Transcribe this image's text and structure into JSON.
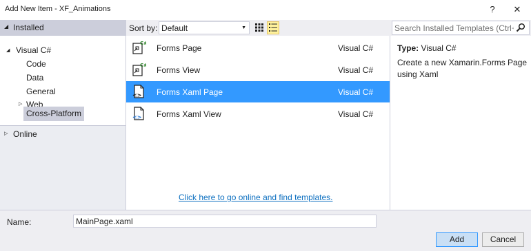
{
  "window": {
    "title": "Add New Item - XF_Animations",
    "help_glyph": "?",
    "close_glyph": "✕"
  },
  "sidebar": {
    "installed_label": "Installed",
    "tree": {
      "visual_csharp": "Visual C#",
      "children": [
        "Code",
        "Data",
        "General",
        "Web",
        "Cross-Platform"
      ],
      "selected": "Cross-Platform"
    },
    "online_label": "Online"
  },
  "toolbar": {
    "sort_label": "Sort by:",
    "sort_value": "Default"
  },
  "templates": [
    {
      "name": "Forms Page",
      "language": "Visual C#",
      "icon": "csharp-form-icon"
    },
    {
      "name": "Forms View",
      "language": "Visual C#",
      "icon": "csharp-form-icon"
    },
    {
      "name": "Forms Xaml Page",
      "language": "Visual C#",
      "icon": "xaml-page-icon",
      "selected": true
    },
    {
      "name": "Forms Xaml View",
      "language": "Visual C#",
      "icon": "xaml-page-icon"
    }
  ],
  "online_link": "Click here to go online and find templates.",
  "search": {
    "placeholder": "Search Installed Templates (Ctrl+E)"
  },
  "details": {
    "type_label": "Type:",
    "type_value": "Visual C#",
    "description": "Create a new Xamarin.Forms Page using Xaml"
  },
  "footer": {
    "name_label": "Name:",
    "name_value": "MainPage.xaml",
    "add_label": "Add",
    "cancel_label": "Cancel"
  },
  "colors": {
    "accent": "#3399ff",
    "link": "#0e70c0",
    "icon_green": "#388a34"
  }
}
